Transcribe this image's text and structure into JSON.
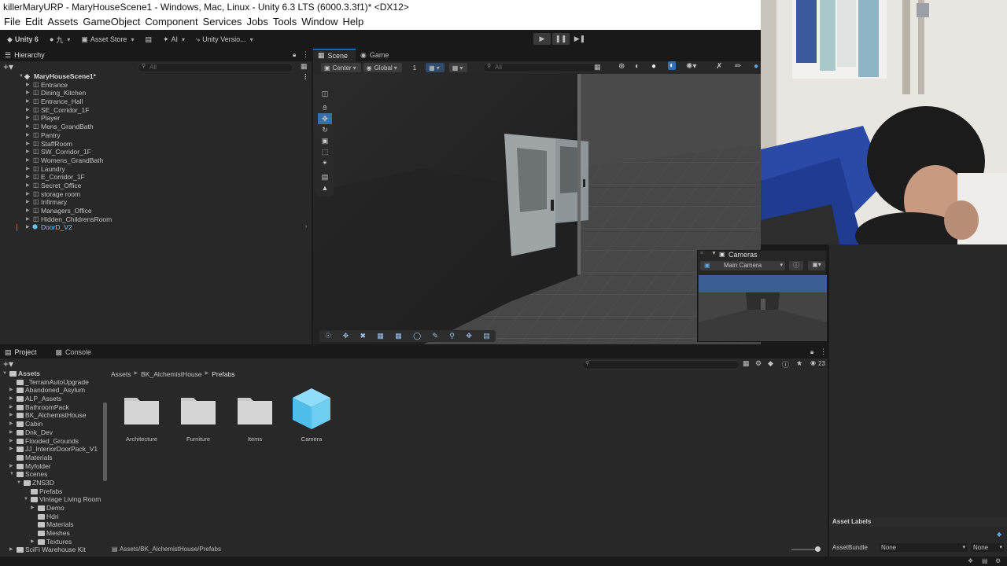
{
  "window": {
    "title": "killerMaryURP - MaryHouseScene1 - Windows, Mac, Linux - Unity 6.3 LTS (6000.3.3f1)* <DX12>"
  },
  "menu": [
    "File",
    "Edit",
    "Assets",
    "GameObject",
    "Component",
    "Services",
    "Jobs",
    "Tools",
    "Window",
    "Help"
  ],
  "toolbar": {
    "unity_label": "Unity 6",
    "account_label": "九",
    "asset_store_label": "Asset Store",
    "ai_label": "AI",
    "version_label": "Unity Versio..."
  },
  "hierarchy": {
    "tab_label": "Hierarchy",
    "search_placeholder": "All",
    "scene_name": "MaryHouseScene1*",
    "items": [
      "Entrance",
      "Dining_Kitchen",
      "Entrance_Hall",
      "SE_Corridor_1F",
      "Player",
      "Mens_GrandBath",
      "Pantry",
      "StaffRoom",
      "SW_Corridor_1F",
      "Womens_GrandBath",
      "Laundry",
      "E_Corridor_1F",
      "Secret_Office",
      "storage room",
      "Infirmary",
      "Managers_Office",
      "Hidden_ChildrensRoom"
    ],
    "prefab_item": "DoorD_V2"
  },
  "scene": {
    "tab_scene": "Scene",
    "tab_game": "Game",
    "pivot_label": "Center",
    "space_label": "Global",
    "snap_value": "1",
    "search_placeholder": "All"
  },
  "cameras": {
    "title": "Cameras",
    "selected_camera": "Main Camera"
  },
  "project": {
    "tab_project": "Project",
    "tab_console": "Console",
    "item_count": "23",
    "breadcrumb": [
      "Assets",
      "BK_AlchemistHouse",
      "Prefabs"
    ],
    "path": "Assets/BK_AlchemistHouse/Prefabs",
    "tree": [
      {
        "label": "Assets",
        "depth": 0,
        "open": true
      },
      {
        "label": "_TerrainAutoUpgrade",
        "depth": 1
      },
      {
        "label": "Abandoned_Asylum",
        "depth": 1,
        "arrow": true
      },
      {
        "label": "ALP_Assets",
        "depth": 1,
        "arrow": true
      },
      {
        "label": "BathroomPack",
        "depth": 1,
        "arrow": true
      },
      {
        "label": "BK_AlchemistHouse",
        "depth": 1,
        "arrow": true
      },
      {
        "label": "Cabin",
        "depth": 1,
        "arrow": true
      },
      {
        "label": "Dnk_Dev",
        "depth": 1,
        "arrow": true
      },
      {
        "label": "Flooded_Grounds",
        "depth": 1,
        "arrow": true
      },
      {
        "label": "JJ_InteriorDoorPack_V1",
        "depth": 1,
        "arrow": true
      },
      {
        "label": "Materials",
        "depth": 1
      },
      {
        "label": "Myfolder",
        "depth": 1,
        "arrow": true
      },
      {
        "label": "Scenes",
        "depth": 1,
        "open": true
      },
      {
        "label": "ZNS3D",
        "depth": 2,
        "open": true
      },
      {
        "label": "Prefabs",
        "depth": 3
      },
      {
        "label": "Vintage Living Room",
        "depth": 3,
        "open": true
      },
      {
        "label": "Demo",
        "depth": 4,
        "arrow": true
      },
      {
        "label": "Hdri",
        "depth": 4
      },
      {
        "label": "Materials",
        "depth": 4
      },
      {
        "label": "Meshes",
        "depth": 4
      },
      {
        "label": "Textures",
        "depth": 4,
        "arrow": true
      },
      {
        "label": "SciFi Warehouse Kit",
        "depth": 1,
        "arrow": true
      }
    ],
    "assets": [
      {
        "label": "Architecture",
        "kind": "folder"
      },
      {
        "label": "Furniture",
        "kind": "folder"
      },
      {
        "label": "Items",
        "kind": "folder"
      },
      {
        "label": "Camera",
        "kind": "prefab"
      }
    ]
  },
  "inspector": {
    "asset_labels": "Asset Labels",
    "asset_bundle_label": "AssetBundle",
    "bundle_value": "None",
    "variant_value": "None"
  },
  "colors": {
    "accent_blue": "#3b8bdb",
    "prefab_blue": "#5fc3f0",
    "panel_bg": "#282828"
  }
}
